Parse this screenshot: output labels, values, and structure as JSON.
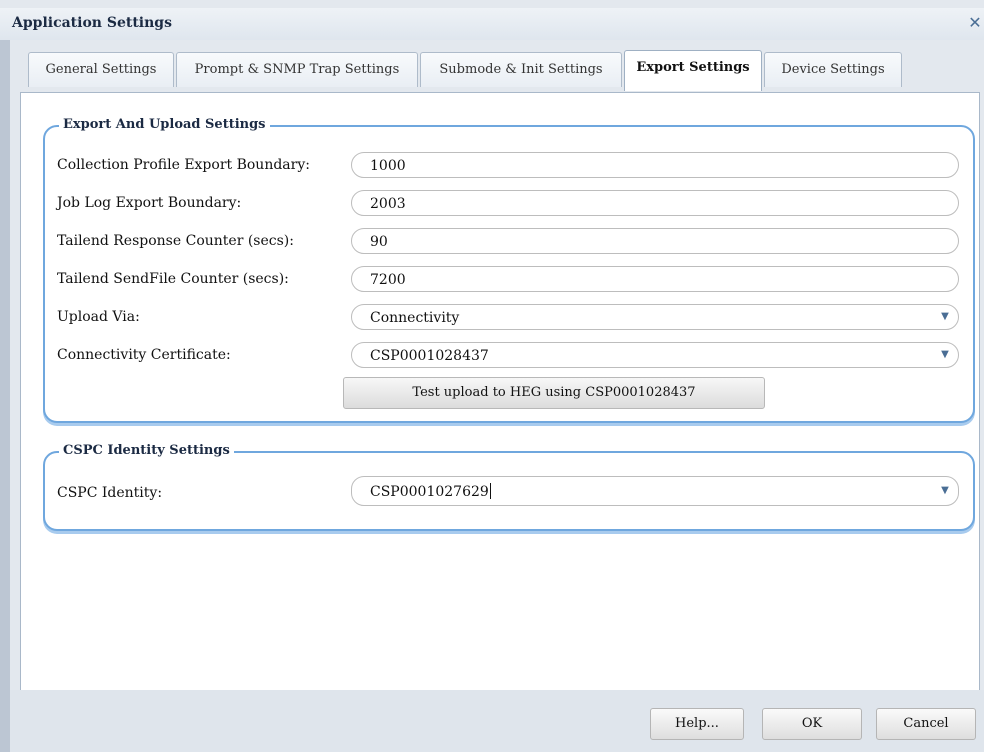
{
  "window": {
    "title": "Application Settings",
    "close_glyph": "✕"
  },
  "tabs": [
    {
      "label": "General Settings"
    },
    {
      "label": "Prompt & SNMP Trap Settings"
    },
    {
      "label": "Submode & Init Settings"
    },
    {
      "label": "Export Settings",
      "active": true
    },
    {
      "label": "Device Settings"
    }
  ],
  "export_section": {
    "legend": "Export And Upload Settings",
    "fields": [
      {
        "label": "Collection Profile Export Boundary:",
        "value": "1000"
      },
      {
        "label": "Job Log Export Boundary:",
        "value": "2003"
      },
      {
        "label": "Tailend Response Counter (secs):",
        "value": "90"
      },
      {
        "label": "Tailend SendFile Counter (secs):",
        "value": "7200"
      }
    ],
    "upload_via": {
      "label": "Upload Via:",
      "value": "Connectivity"
    },
    "certificate": {
      "label": "Connectivity Certificate:",
      "value": "CSP0001028437"
    },
    "test_button": "Test upload to HEG using CSP0001028437"
  },
  "identity_section": {
    "legend": "CSPC Identity Settings",
    "identity": {
      "label": "CSPC Identity:",
      "value": "CSP0001027629"
    }
  },
  "footer": {
    "help": "Help...",
    "ok": "OK",
    "cancel": "Cancel"
  },
  "icons": {
    "dropdown": "chevron-down-icon",
    "close": "close-icon"
  }
}
